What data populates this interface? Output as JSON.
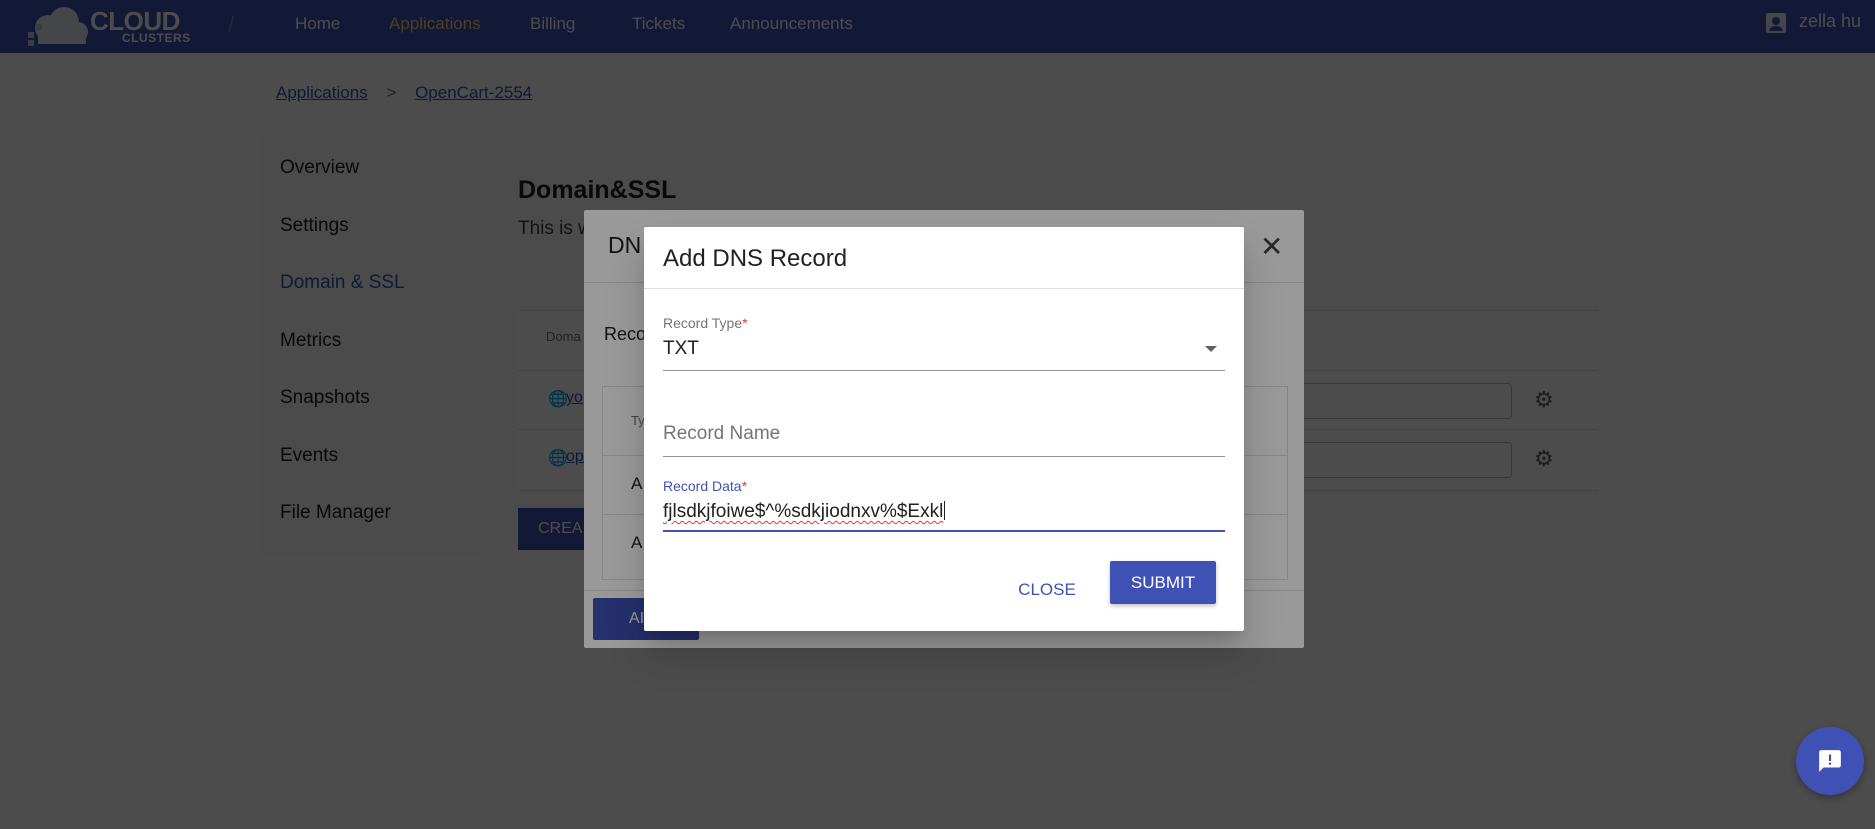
{
  "app": {
    "logo_text": "CLOUD",
    "logo_subtext": "CLUSTERS",
    "logo_separator": "/"
  },
  "nav": {
    "items": [
      {
        "label": "Home"
      },
      {
        "label": "Applications",
        "active": true
      },
      {
        "label": "Billing"
      },
      {
        "label": "Tickets"
      },
      {
        "label": "Announcements"
      }
    ],
    "user_name": "zella hu"
  },
  "breadcrumb": {
    "items": [
      "Applications",
      "OpenCart-2554"
    ],
    "separator": ">"
  },
  "sidebar": {
    "items": [
      {
        "label": "Overview"
      },
      {
        "label": "Settings"
      },
      {
        "label": "Domain & SSL",
        "active": true
      },
      {
        "label": "Metrics"
      },
      {
        "label": "Snapshots"
      },
      {
        "label": "Events"
      },
      {
        "label": "File Manager"
      }
    ]
  },
  "main": {
    "section_title": "Domain&SSL",
    "section_subtitle_visible": "This is w",
    "table_header_visible": "Doma",
    "rows": [
      {
        "domain_visible": "yo"
      },
      {
        "domain_visible": "op"
      }
    ],
    "create_button_visible": "CREA"
  },
  "dns_dialog": {
    "title_visible": "DN",
    "records_label_visible": "Reco",
    "table_header_visible": "Ty",
    "rows": [
      {
        "type": "A"
      },
      {
        "type": "A"
      }
    ],
    "add_button_visible": "AI"
  },
  "add_record_dialog": {
    "title": "Add DNS Record",
    "record_type": {
      "label": "Record Type",
      "required_mark": "*",
      "value": "TXT"
    },
    "record_name": {
      "placeholder": "Record Name",
      "value": ""
    },
    "record_data": {
      "label": "Record Data",
      "required_mark": "*",
      "value": "fjlsdkjfoiwe$^%sdkjiodnxv%$Exkl"
    },
    "close_label": "CLOSE",
    "submit_label": "SUBMIT"
  },
  "colors": {
    "primary": "#3f51b5",
    "nav_active": "#f3d27a",
    "required": "#e53935"
  },
  "icons": {
    "close": "close-icon",
    "gear": "gear-icon",
    "globe": "globe-icon",
    "dropdown": "chevron-down-icon",
    "chat": "chat-icon",
    "user": "account-icon"
  }
}
